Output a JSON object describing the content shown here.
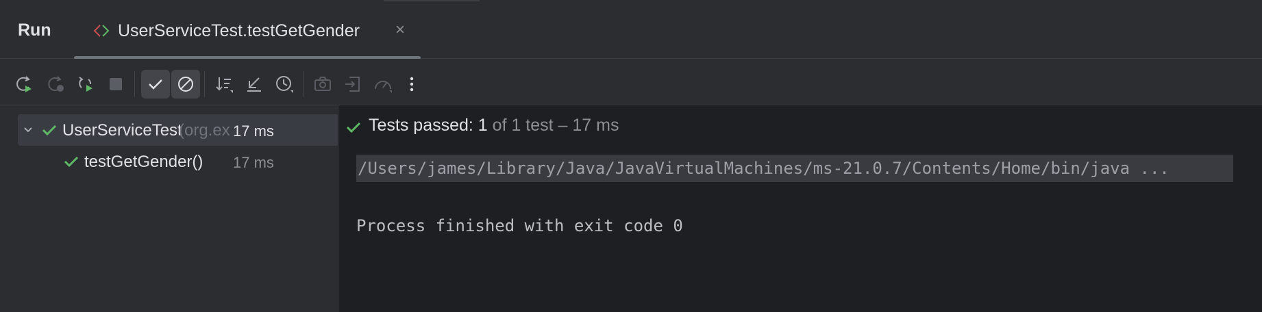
{
  "header": {
    "run_label": "Run",
    "tab": {
      "label": "UserServiceTest.testGetGender",
      "close_glyph": "×"
    }
  },
  "toolbar": {
    "buttons": [
      {
        "name": "rerun-icon",
        "state": "enabled"
      },
      {
        "name": "rerun-failed-icon",
        "state": "disabled"
      },
      {
        "name": "toggle-auto-test-icon",
        "state": "enabled"
      },
      {
        "name": "stop-icon",
        "state": "disabled"
      },
      {
        "name": "show-passed-icon",
        "state": "active"
      },
      {
        "name": "show-ignored-icon",
        "state": "active"
      },
      {
        "name": "sort-icon",
        "state": "enabled"
      },
      {
        "name": "collapse-icon",
        "state": "enabled"
      },
      {
        "name": "history-icon",
        "state": "enabled"
      },
      {
        "name": "camera-icon",
        "state": "disabled"
      },
      {
        "name": "import-icon",
        "state": "disabled"
      },
      {
        "name": "gauge-icon",
        "state": "disabled"
      },
      {
        "name": "more-icon",
        "state": "enabled"
      }
    ]
  },
  "tree": {
    "root": {
      "name": "UserServiceTest",
      "package": "(org.ex",
      "time": "17 ms"
    },
    "child": {
      "name": "testGetGender()",
      "time": "17 ms"
    }
  },
  "console": {
    "status": {
      "passed_label": "Tests passed: 1",
      "summary": " of 1 test – 17 ms"
    },
    "command_line": "/Users/james/Library/Java/JavaVirtualMachines/ms-21.0.7/Contents/Home/bin/java ...",
    "exit_line": "Process finished with exit code 0"
  },
  "colors": {
    "success": "#5fb865",
    "panel_bg": "#2b2d30",
    "console_bg": "#1e1f22",
    "text": "#dfe1e5",
    "muted": "#8c8f94"
  }
}
